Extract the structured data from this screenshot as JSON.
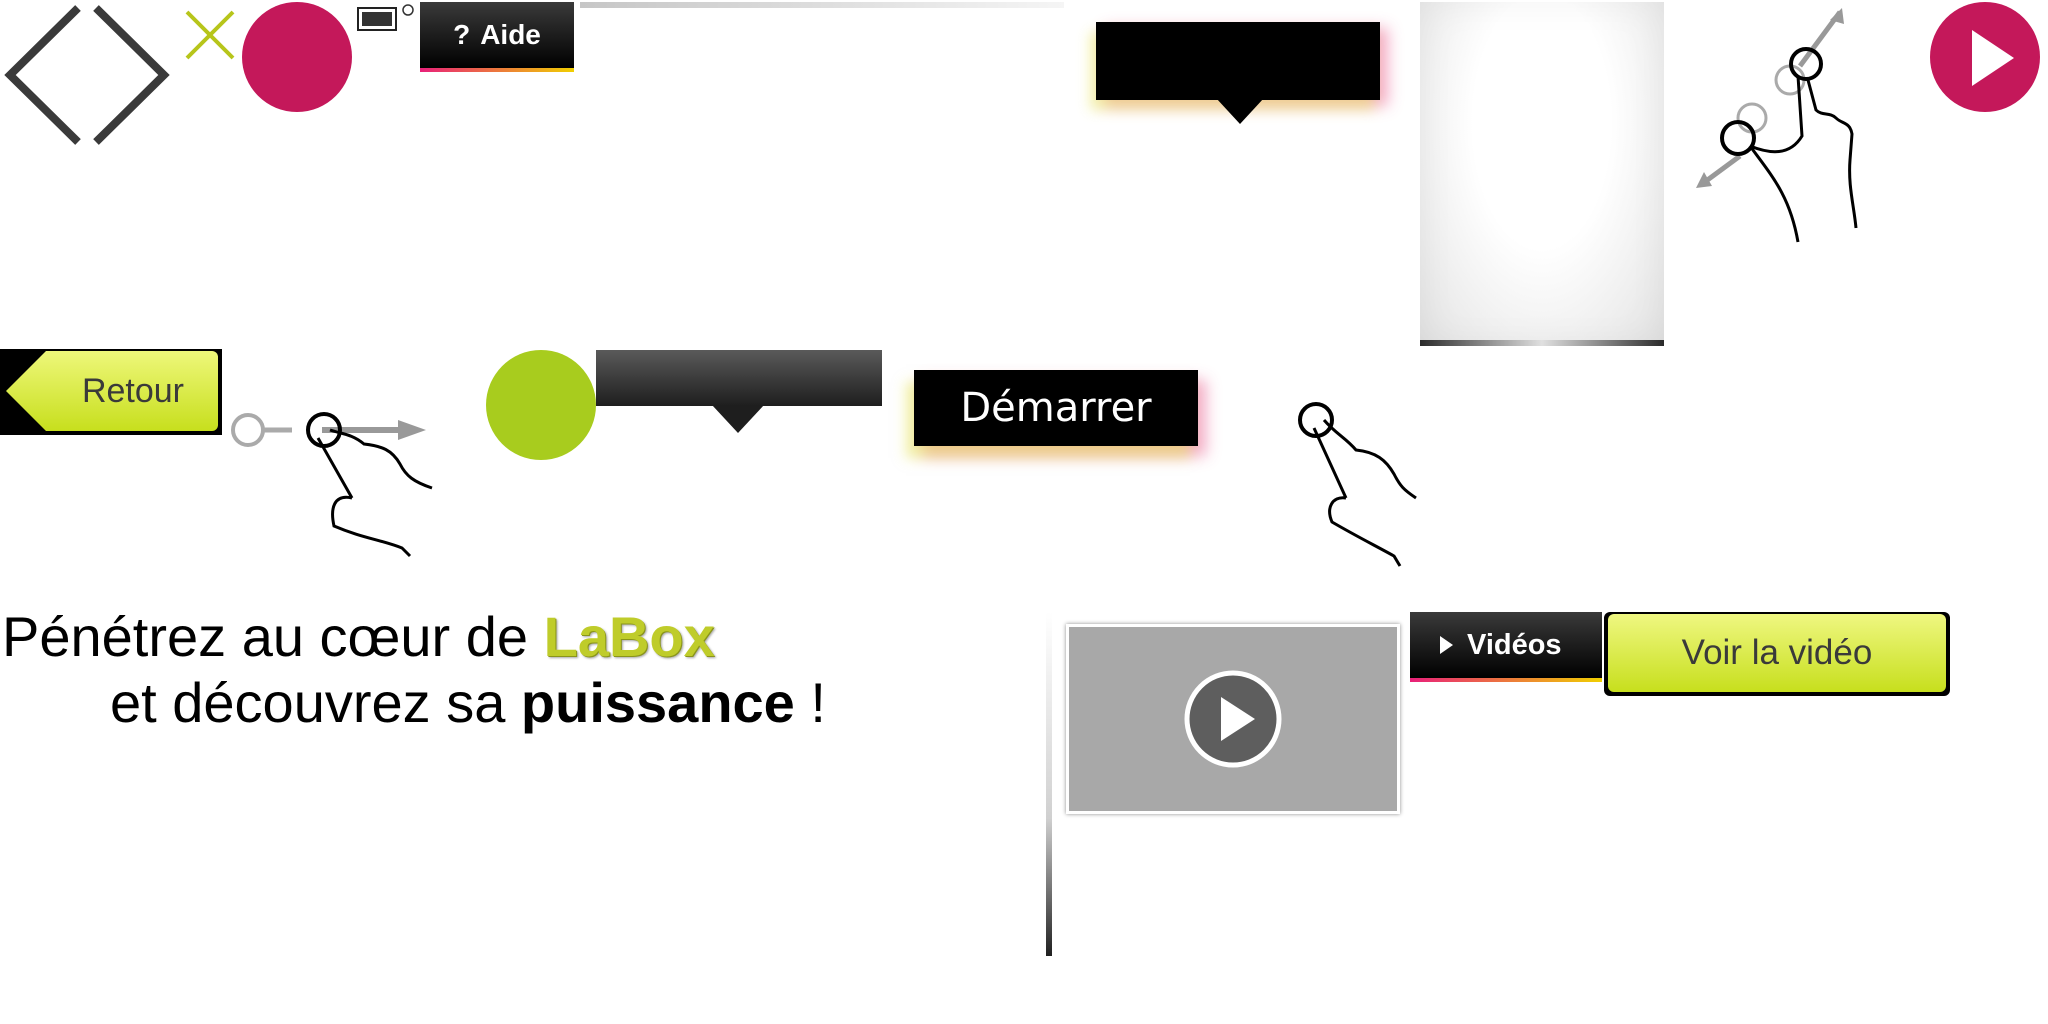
{
  "help_button": {
    "icon": "question-icon",
    "icon_glyph": "?",
    "label": "Aide"
  },
  "back_button": {
    "label": "Retour"
  },
  "start_button": {
    "label": "Démarrer"
  },
  "headline": {
    "line1_prefix": "Pénétrez au cœur de ",
    "brand": "LaBox",
    "line2_prefix": "et découvrez sa ",
    "emphasis": "puissance",
    "line2_suffix": " !"
  },
  "videos_button": {
    "label": "Vidéos"
  },
  "watch_button": {
    "label": "Voir la vidéo"
  },
  "colors": {
    "magenta": "#c4185a",
    "lime": "#a8cc1e",
    "button_lime": "#c7df1d",
    "brand_text": "#bfcc2a"
  },
  "icons": [
    "diamond-frame-icon",
    "close-x-icon",
    "window-icon",
    "refresh-icon",
    "pinch-zoom-gesture-icon",
    "play-icon",
    "swipe-gesture-icon",
    "tap-gesture-icon"
  ]
}
